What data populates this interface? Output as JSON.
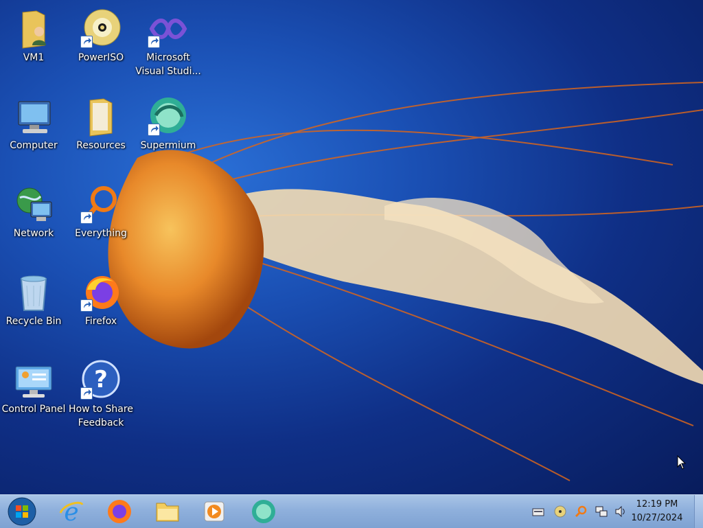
{
  "desktop": {
    "icons": [
      {
        "label": "VM1",
        "icon": "user-folder-icon",
        "shortcut": false
      },
      {
        "label": "PowerISO",
        "icon": "poweriso-disc-icon",
        "shortcut": true
      },
      {
        "label": "Microsoft Visual Studi...",
        "icon": "visual-studio-icon",
        "shortcut": true
      },
      {
        "label": "Computer",
        "icon": "computer-icon",
        "shortcut": false
      },
      {
        "label": "Resources",
        "icon": "folder-icon",
        "shortcut": false
      },
      {
        "label": "Supermium",
        "icon": "supermium-icon",
        "shortcut": true
      },
      {
        "label": "Network",
        "icon": "network-icon",
        "shortcut": false
      },
      {
        "label": "Everything",
        "icon": "everything-search-icon",
        "shortcut": true
      },
      {
        "label": "Recycle Bin",
        "icon": "recycle-bin-icon",
        "shortcut": false
      },
      {
        "label": "Firefox",
        "icon": "firefox-icon",
        "shortcut": true
      },
      {
        "label": "Control Panel",
        "icon": "control-panel-icon",
        "shortcut": false
      },
      {
        "label": "How to Share Feedback",
        "icon": "help-icon",
        "shortcut": true
      }
    ]
  },
  "taskbar": {
    "pinned": [
      "start-orb-icon",
      "internet-explorer-icon",
      "firefox-icon",
      "file-explorer-icon",
      "media-player-icon",
      "supermium-icon"
    ],
    "tray": {
      "icons": [
        "keyboard-icon",
        "poweriso-tray-icon",
        "everything-tray-icon",
        "network-tray-icon",
        "volume-icon"
      ],
      "time": "12:19 PM",
      "date": "10/27/2024"
    }
  },
  "colors": {
    "desktop_bg": "#0f2f86",
    "taskbar": "#8fb0dc",
    "jellyfish": "#e8892a"
  }
}
